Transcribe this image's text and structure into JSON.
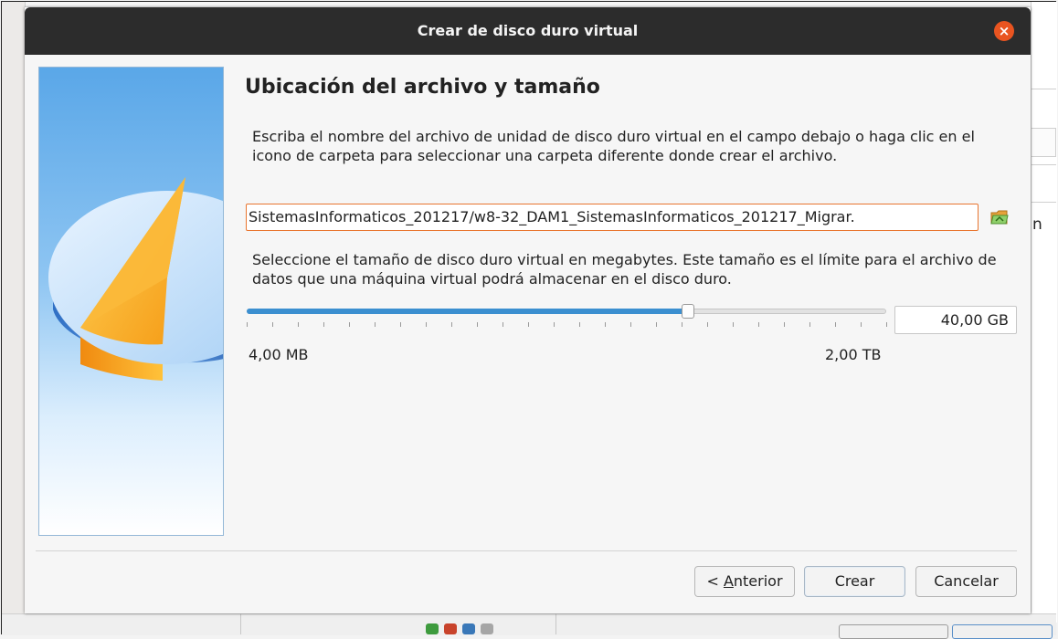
{
  "dialog": {
    "title": "Crear de disco duro virtual",
    "close_symbol": "×",
    "heading": "Ubicación del archivo y tamaño",
    "description_location": "Escriba el nombre del archivo de unidad de disco duro virtual en el campo debajo o haga clic en el icono de carpeta para seleccionar una carpeta diferente donde crear el archivo.",
    "file_path_value": "SistemasInformaticos_201217/w8-32_DAM1_SistemasInformaticos_201217_Migrar.",
    "folder_icon": "folder-open-icon",
    "description_size": "Seleccione el tamaño de disco duro virtual en megabytes. Este tamaño es el límite para el archivo de datos que una máquina virtual podrá almacenar en el disco duro.",
    "size_value": "40,00 GB",
    "slider_fraction": 0.69,
    "slider_min_label": "4,00 MB",
    "slider_max_label": "2,00 TB",
    "buttons": {
      "back_prefix": "< ",
      "back_mnemonic": "A",
      "back_rest": "nterior",
      "create": "Crear",
      "cancel": "Cancelar"
    }
  },
  "background": {
    "right_letter": "n"
  },
  "colors": {
    "accent_orange": "#e95420",
    "slider_fill": "#3b8fd0",
    "titlebar": "#2c2c2c"
  }
}
